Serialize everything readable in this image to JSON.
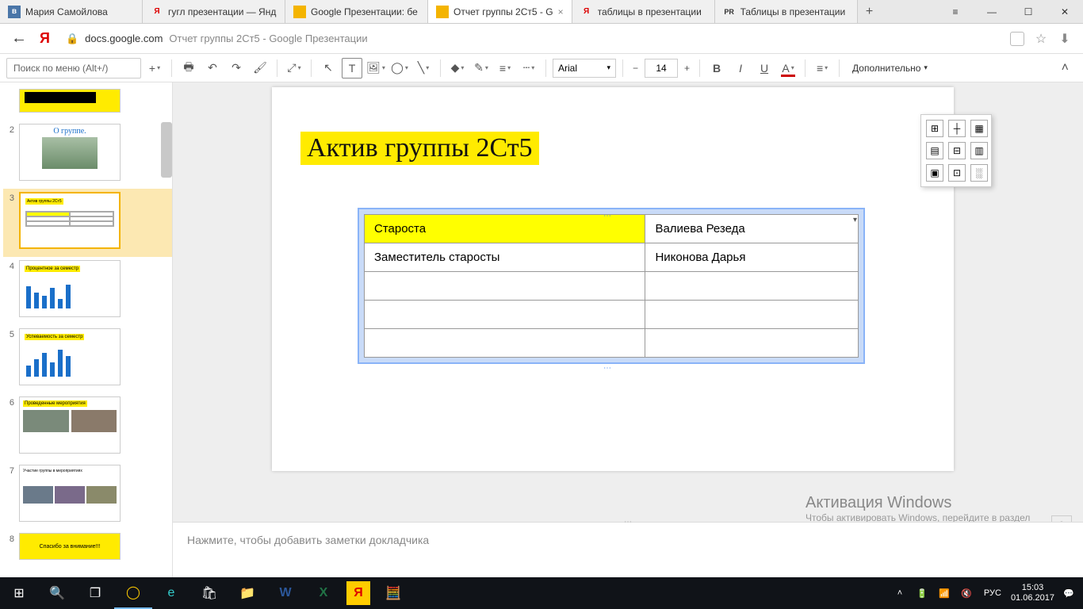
{
  "browser": {
    "tabs": [
      {
        "label": "Мария Самойлова",
        "favicon": "vk"
      },
      {
        "label": "гугл презентации — Янд",
        "favicon": "Я"
      },
      {
        "label": "Google Презентации: бе",
        "favicon": "□"
      },
      {
        "label": "Отчет группы 2Ст5 - G",
        "favicon": "□",
        "active": true
      },
      {
        "label": "таблицы в презентации",
        "favicon": "Я"
      },
      {
        "label": "Таблицы в презентации",
        "favicon": "PR"
      }
    ],
    "new_tab": "+",
    "win_menu": "≡",
    "win_min": "—",
    "win_max": "☐",
    "win_close": "✕"
  },
  "address": {
    "back": "←",
    "logo": "Я",
    "lock": "🔒",
    "domain": "docs.google.com",
    "title": "Отчет группы 2Ст5 - Google Презентации",
    "bookmark": "☆",
    "download": "⬇"
  },
  "toolbar": {
    "menu_search_placeholder": "Поиск по меню (Alt+/)",
    "new_slide": "+",
    "undo": "↶",
    "redo": "↷",
    "print": "🖶",
    "paint": "🖌",
    "zoom": "⤢",
    "select": "↖",
    "textbox": "T",
    "image": "🖼",
    "shape": "◯",
    "line": "╲",
    "fill": "◆",
    "border_color": "✎",
    "border_weight": "≡",
    "border_dash": "┄",
    "font": "Arial",
    "size_minus": "−",
    "size": "14",
    "size_plus": "+",
    "bold": "B",
    "italic": "I",
    "underline": "U",
    "text_color": "A",
    "align": "≡",
    "more": "Дополнительно",
    "collapse": "˄"
  },
  "slides": {
    "items": [
      {
        "num": "",
        "kind": "top"
      },
      {
        "num": "2",
        "kind": "about",
        "title": "О группе."
      },
      {
        "num": "3",
        "kind": "table",
        "title": "Актив группы 2Ст5",
        "selected": true
      },
      {
        "num": "4",
        "kind": "bars",
        "title": "Процентное за семестр"
      },
      {
        "num": "5",
        "kind": "bars2",
        "title": "Успеваемость за семестр"
      },
      {
        "num": "6",
        "kind": "photos",
        "title": "Проведенные мероприятия"
      },
      {
        "num": "7",
        "kind": "photos2",
        "title": "Участие группы в мероприятиях"
      },
      {
        "num": "8",
        "kind": "thanks",
        "title": "Спасибо за внимание!!!"
      }
    ]
  },
  "slide": {
    "title": "Актив группы 2Ст5",
    "table": {
      "rows": [
        {
          "c1": "Староста",
          "c2": "Валиева Резеда",
          "c1_yellow": true
        },
        {
          "c1": "Заместитель старосты",
          "c2": "Никонова Дарья"
        },
        {
          "c1": "",
          "c2": ""
        },
        {
          "c1": "",
          "c2": ""
        },
        {
          "c1": "",
          "c2": ""
        }
      ],
      "dropdown": "▾"
    }
  },
  "border_palette": [
    "⊞",
    "┼",
    "▦",
    "▤",
    "⊟",
    "▥",
    "▣",
    "⊡",
    "░"
  ],
  "notes": {
    "placeholder": "Нажмите, чтобы добавить заметки докладчика",
    "drag": "⋯"
  },
  "watermark": {
    "line1": "Активация Windows",
    "line2": "Чтобы активировать Windows, перейдите в раздел \"Параметры\"."
  },
  "feedback": "⊕",
  "taskbar": {
    "items": [
      "⊞",
      "🔍",
      "❐",
      "◯",
      "e",
      "🛍",
      "📁",
      "W",
      "X",
      "Я",
      "🧮"
    ],
    "tray": {
      "up": "˄",
      "battery": "🔋",
      "wifi": "📶",
      "vol": "🔇",
      "lang": "РУС",
      "time": "15:03",
      "date": "01.06.2017",
      "notif": "💬"
    }
  }
}
